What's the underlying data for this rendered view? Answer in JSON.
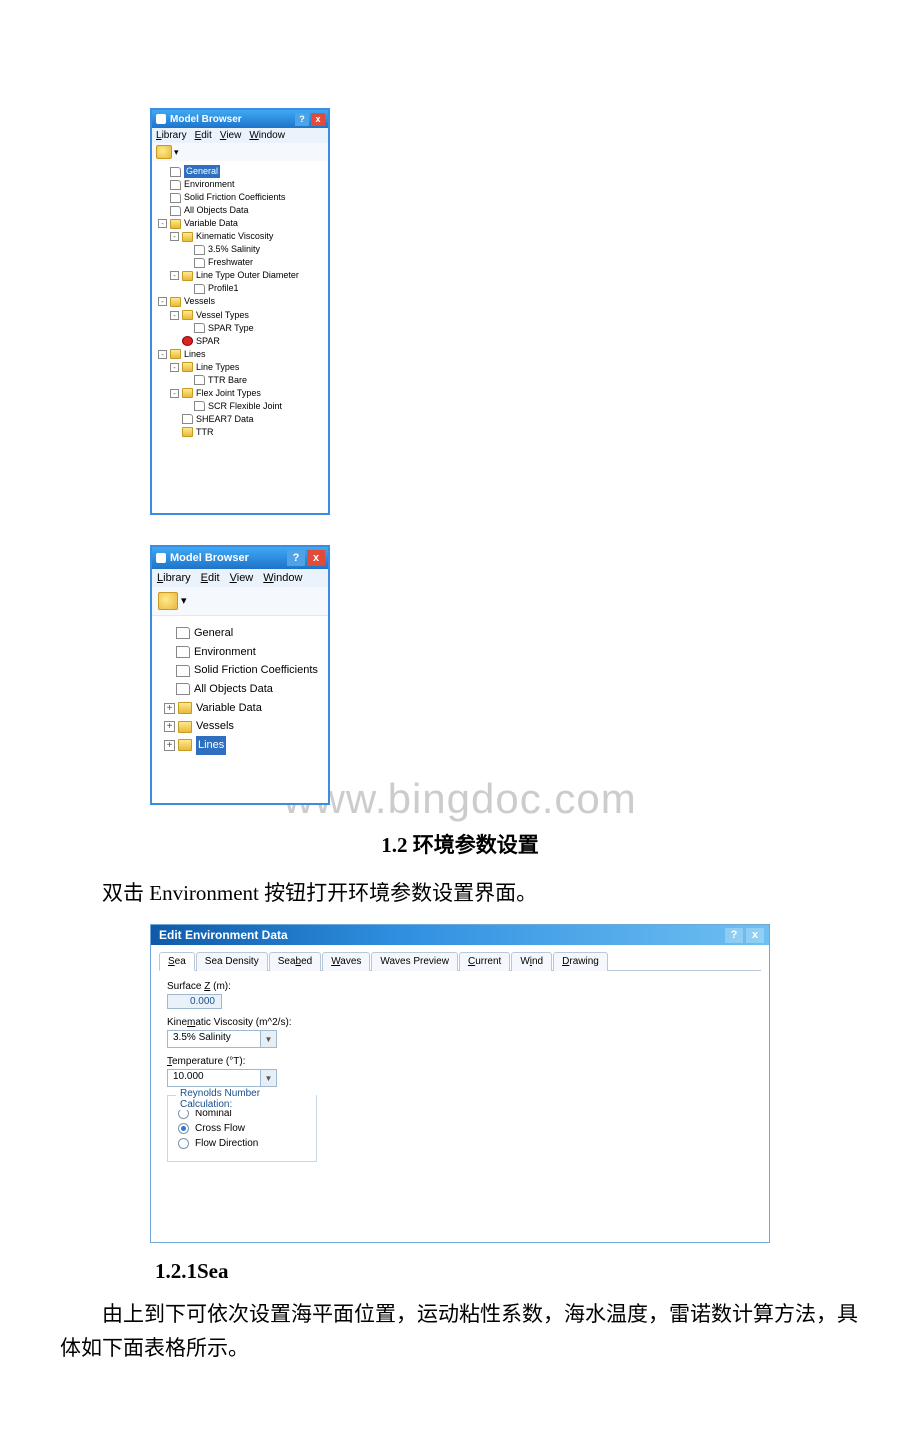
{
  "browser1": {
    "title": "Model Browser",
    "menus": [
      "Library",
      "Edit",
      "View",
      "Window"
    ],
    "menus_u": [
      "L",
      "E",
      "V",
      "W"
    ],
    "tree": [
      {
        "indent": 0,
        "exp": null,
        "icon": "file",
        "label": "General",
        "sel": true
      },
      {
        "indent": 0,
        "exp": null,
        "icon": "file",
        "label": "Environment"
      },
      {
        "indent": 0,
        "exp": null,
        "icon": "file",
        "label": "Solid Friction Coefficients"
      },
      {
        "indent": 0,
        "exp": null,
        "icon": "file",
        "label": "All Objects Data"
      },
      {
        "indent": 0,
        "exp": "-",
        "icon": "folder-open",
        "label": "Variable Data"
      },
      {
        "indent": 1,
        "exp": "-",
        "icon": "folder-open",
        "label": "Kinematic Viscosity"
      },
      {
        "indent": 2,
        "exp": null,
        "icon": "file",
        "label": "3.5% Salinity"
      },
      {
        "indent": 2,
        "exp": null,
        "icon": "file",
        "label": "Freshwater"
      },
      {
        "indent": 1,
        "exp": "-",
        "icon": "folder-open",
        "label": "Line Type Outer Diameter"
      },
      {
        "indent": 2,
        "exp": null,
        "icon": "file",
        "label": "Profile1"
      },
      {
        "indent": 0,
        "exp": "-",
        "icon": "folder-open",
        "label": "Vessels"
      },
      {
        "indent": 1,
        "exp": "-",
        "icon": "folder-open",
        "label": "Vessel Types"
      },
      {
        "indent": 2,
        "exp": null,
        "icon": "file",
        "label": "SPAR Type"
      },
      {
        "indent": 1,
        "exp": null,
        "icon": "vessel",
        "label": "SPAR"
      },
      {
        "indent": 0,
        "exp": "-",
        "icon": "folder-open",
        "label": "Lines"
      },
      {
        "indent": 1,
        "exp": "-",
        "icon": "folder-open",
        "label": "Line Types"
      },
      {
        "indent": 2,
        "exp": null,
        "icon": "file",
        "label": "TTR Bare"
      },
      {
        "indent": 1,
        "exp": "-",
        "icon": "folder-open",
        "label": "Flex Joint Types"
      },
      {
        "indent": 2,
        "exp": null,
        "icon": "file",
        "label": "SCR Flexible Joint"
      },
      {
        "indent": 1,
        "exp": null,
        "icon": "file",
        "label": "SHEAR7 Data"
      },
      {
        "indent": 1,
        "exp": null,
        "icon": "folder",
        "label": "TTR"
      }
    ]
  },
  "browser2": {
    "title": "Model Browser",
    "menus": [
      "Library",
      "Edit",
      "View",
      "Window"
    ],
    "menus_u": [
      "L",
      "E",
      "V",
      "W"
    ],
    "tree": [
      {
        "indent": 0,
        "exp": null,
        "icon": "file",
        "label": "General"
      },
      {
        "indent": 0,
        "exp": null,
        "icon": "file",
        "label": "Environment"
      },
      {
        "indent": 0,
        "exp": null,
        "icon": "file",
        "label": "Solid Friction Coefficients"
      },
      {
        "indent": 0,
        "exp": null,
        "icon": "file",
        "label": "All Objects Data"
      },
      {
        "indent": 0,
        "exp": "+",
        "icon": "folder",
        "label": "Variable Data"
      },
      {
        "indent": 0,
        "exp": "+",
        "icon": "folder",
        "label": "Vessels"
      },
      {
        "indent": 0,
        "exp": "+",
        "icon": "folder-open",
        "label": "Lines",
        "sel": true
      }
    ]
  },
  "watermark": "www.bingdoc.com",
  "section_1_2": "1.2 环境参数设置",
  "para_1_2": "双击 Environment 按钮打开环境参数设置界面。",
  "dialog": {
    "title": "Edit Environment Data",
    "tabs": [
      {
        "label": "Sea",
        "u": "S",
        "active": true
      },
      {
        "label": "Sea Density",
        "u": "",
        "active": false
      },
      {
        "label": "Seabed",
        "u": "b",
        "active": false
      },
      {
        "label": "Waves",
        "u": "W",
        "active": false
      },
      {
        "label": "Waves Preview",
        "u": "",
        "active": false
      },
      {
        "label": "Current",
        "u": "C",
        "active": false
      },
      {
        "label": "Wind",
        "u": "i",
        "active": false
      },
      {
        "label": "Drawing",
        "u": "D",
        "active": false
      }
    ],
    "surface_label": "Surface Z (m):",
    "surface_u": "Z",
    "surface_value": "0.000",
    "kv_label": "Kinematic Viscosity (m^2/s):",
    "kv_u": "m",
    "kv_value": "3.5% Salinity",
    "temp_label": "Temperature (°T):",
    "temp_u": "T",
    "temp_value": "10.000",
    "reynolds_title": "Reynolds Number Calculation:",
    "reynolds_options": [
      "Nominal",
      "Cross Flow",
      "Flow Direction"
    ],
    "reynolds_selected": 1
  },
  "section_1_2_1": "1.2.1Sea",
  "para_1_2_1": "由上到下可依次设置海平面位置，运动粘性系数，海水温度，雷诺数计算方法，具体如下面表格所示。"
}
